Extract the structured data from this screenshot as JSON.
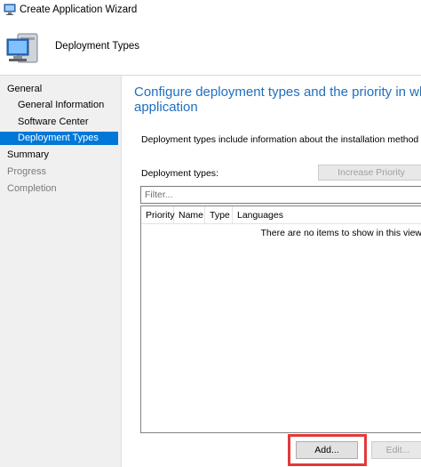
{
  "window": {
    "title": "Create Application Wizard"
  },
  "header": {
    "heading": "Deployment Types"
  },
  "sidebar": {
    "items": [
      {
        "label": "General",
        "state": "normal"
      },
      {
        "label": "General Information",
        "state": "normal"
      },
      {
        "label": "Software Center",
        "state": "normal"
      },
      {
        "label": "Deployment Types",
        "state": "selected"
      },
      {
        "label": "Summary",
        "state": "normal"
      },
      {
        "label": "Progress",
        "state": "disabled"
      },
      {
        "label": "Completion",
        "state": "disabled"
      }
    ]
  },
  "main": {
    "title_line1": "Configure deployment types and the priority in which t",
    "title_line2": "application",
    "description": "Deployment types include information about the installation method and the so",
    "deployment_types_label": "Deployment types:",
    "increase_priority_label": "Increase Priority",
    "filter_placeholder": "Filter...",
    "columns": [
      "Priority",
      "Name",
      "Type",
      "Languages"
    ],
    "empty_message": "There are no items to show in this view",
    "add_label": "Add...",
    "edit_label": "Edit..."
  },
  "colors": {
    "accent": "#0078d7",
    "heading": "#1f6fbf",
    "highlight_box": "#e03a3a"
  }
}
